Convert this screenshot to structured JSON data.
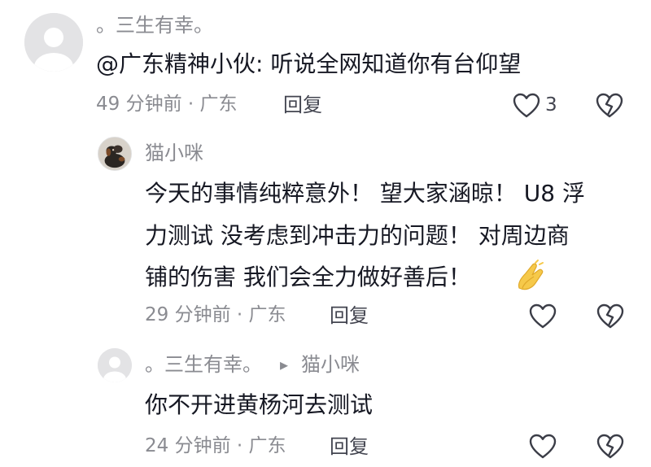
{
  "comments": [
    {
      "author": "。三生有幸。",
      "text": "@广东精神小伙: 听说全网知道你有台仰望",
      "meta": "49 分钟前 · 广东",
      "reply_label": "回复",
      "like_count": "3"
    },
    {
      "author": "猫小咪",
      "lines": [
        "今天的事情纯粹意外！ 望大家涵晾！ U8 浮",
        "力测试 没考虑到冲击力的问题！ 对周边商",
        "铺的伤害 我们会全力做好善后！"
      ],
      "emoji": "hands-together-icon",
      "meta": "29 分钟前 · 广东",
      "reply_label": "回复"
    },
    {
      "author": "。三生有幸。",
      "reply_to_arrow": "▸",
      "reply_to": "猫小咪",
      "text": "你不开进黄杨河去测试",
      "meta": "24 分钟前 · 广东",
      "reply_label": "回复"
    }
  ],
  "icons": {
    "like": "heart-outline-icon",
    "dislike": "broken-heart-icon",
    "default_avatar": "default-avatar-icon",
    "cat_avatar": "dog-avatar-image"
  },
  "colors": {
    "text_primary": "#161823",
    "text_secondary": "#8a8b91",
    "emoji": "#f5c542"
  }
}
